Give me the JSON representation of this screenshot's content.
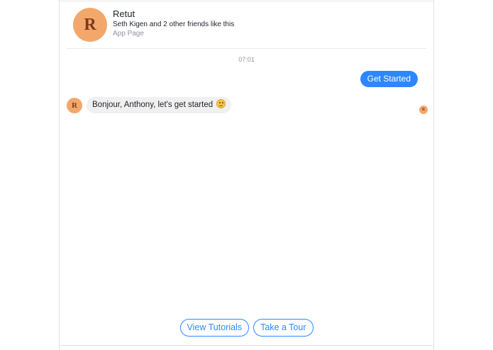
{
  "page_header": {
    "avatar_letter": "R",
    "name": "Retut",
    "likes_text": "Seth Kigen and 2 other friends like this",
    "page_type": "App Page"
  },
  "conversation": {
    "timestamp": "07:01",
    "outgoing_message": "Get Started",
    "incoming_avatar_letter": "R",
    "incoming_message": "Bonjour, Anthony, let's get started",
    "incoming_emoji": "slightly-smiling-face-icon",
    "read_receipt_letter": "R"
  },
  "quick_replies": [
    {
      "label": "View Tutorials"
    },
    {
      "label": "Take a Tour"
    }
  ],
  "colors": {
    "accent": "#2d88ff",
    "avatar": "#f4a76b",
    "avatar_text": "#7a3a1c",
    "incoming_bubble": "#f1f0f0",
    "secondary_text": "#90949c"
  }
}
